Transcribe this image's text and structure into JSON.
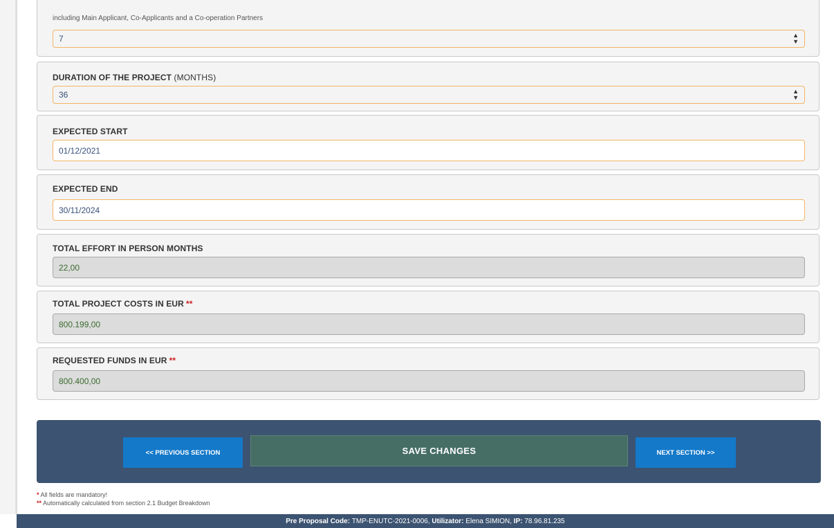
{
  "partners_panel": {
    "subtext": "including Main Applicant, Co-Applicants and a Co-operation Partners",
    "value": "7"
  },
  "duration_panel": {
    "label": "DURATION OF THE PROJECT",
    "label_suffix": "(MONTHS)",
    "value": "36"
  },
  "expected_start": {
    "label": "EXPECTED START",
    "value": "01/12/2021"
  },
  "expected_end": {
    "label": "EXPECTED END",
    "value": "30/11/2024"
  },
  "total_effort": {
    "label": "TOTAL EFFORT IN PERSON MONTHS",
    "value": "22,00"
  },
  "total_costs": {
    "label": "TOTAL PROJECT COSTS IN EUR",
    "marker": "**",
    "value": "800.199,00"
  },
  "requested_funds": {
    "label": "REQUESTED FUNDS IN EUR",
    "marker": "**",
    "value": "800.400,00"
  },
  "actions": {
    "previous_label": "<< PREVIOUS SECTION",
    "save_label": "SAVE CHANGES",
    "next_label": "NEXT SECTION >>"
  },
  "notes": {
    "mandatory_marker": "*",
    "mandatory_text": "All fields are mandatory!",
    "auto_marker": "**",
    "auto_text": "Automatically calculated from section 2.1 Budget Breakdown"
  },
  "footer": {
    "code_label": "Pre Proposal Code:",
    "code_value": "TMP-ENUTC-2021-0006,",
    "user_label": "Utilizator:",
    "user_value": "Elena SIMION,",
    "ip_label": "IP:",
    "ip_value": "78.96.81.235"
  },
  "colors": {
    "action_bar": "#3c5371",
    "primary_button": "#1479c9",
    "save_button": "#466e64",
    "field_border_active": "#f2b564",
    "required_marker": "#cc1f1f"
  }
}
